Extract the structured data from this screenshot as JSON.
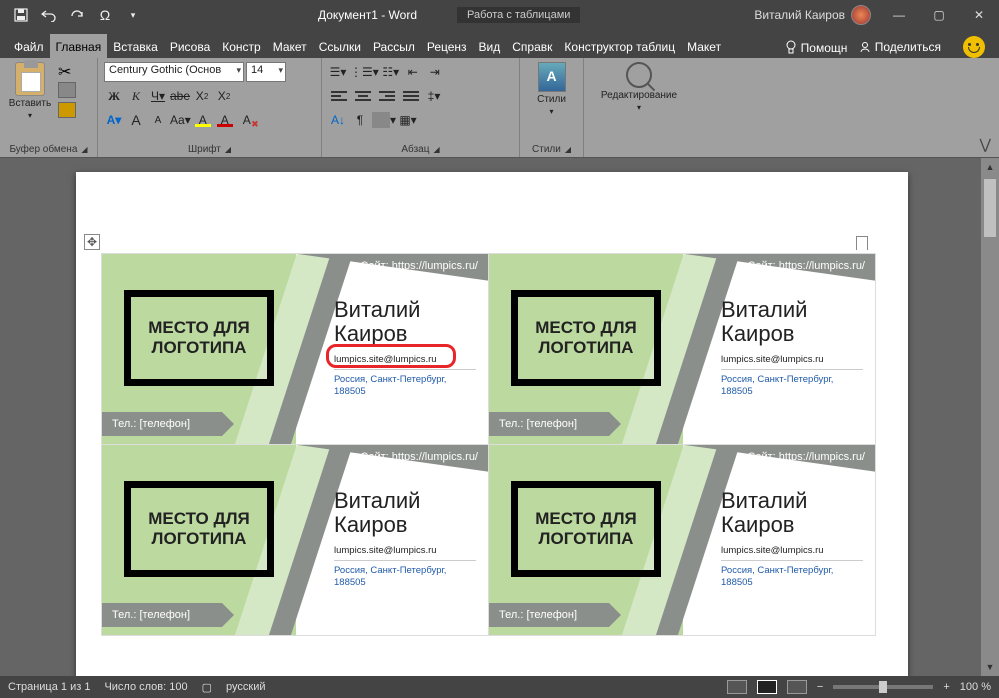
{
  "titlebar": {
    "doc_title": "Документ1 - Word",
    "table_tools": "Работа с таблицами",
    "user_name": "Виталий Каиров",
    "qat": {
      "omega": "Ω"
    }
  },
  "tabs": {
    "file": "Файл",
    "home": "Главная",
    "insert": "Вставка",
    "draw": "Рисова",
    "design": "Констр",
    "layout": "Макет",
    "references": "Ссылки",
    "mailings": "Рассыл",
    "review": "Реценз",
    "view": "Вид",
    "help": "Справк",
    "table_design": "Конструктор таблиц",
    "table_layout": "Макет",
    "tell_me": "Помощн",
    "share": "Поделиться"
  },
  "ribbon": {
    "clipboard": {
      "paste": "Вставить",
      "group": "Буфер обмена"
    },
    "font": {
      "name": "Century Gothic (Основ",
      "size": "14",
      "bold": "Ж",
      "italic": "К",
      "underline": "Ч",
      "strike": "abe",
      "sub": "X",
      "sup": "X",
      "grow": "A",
      "shrink": "A",
      "case": "Aa",
      "highlight": "A",
      "color": "A",
      "group": "Шрифт"
    },
    "paragraph": {
      "group": "Абзац"
    },
    "styles": {
      "label": "Стили",
      "group": "Стили"
    },
    "editing": {
      "label": "Редактирование"
    }
  },
  "card": {
    "site": "Сайт: https://lumpics.ru/",
    "logo": "МЕСТО ДЛЯ ЛОГОТИПА",
    "name_first": "Виталий",
    "name_last": "Каиров",
    "email": "lumpics.site@lumpics.ru",
    "addr1": "Россия, Санкт-Петербург,",
    "addr2": "188505",
    "tel": "Тел.: [телефон]"
  },
  "statusbar": {
    "page": "Страница 1 из 1",
    "words": "Число слов: 100",
    "lang": "русский",
    "zoom": "100 %"
  }
}
